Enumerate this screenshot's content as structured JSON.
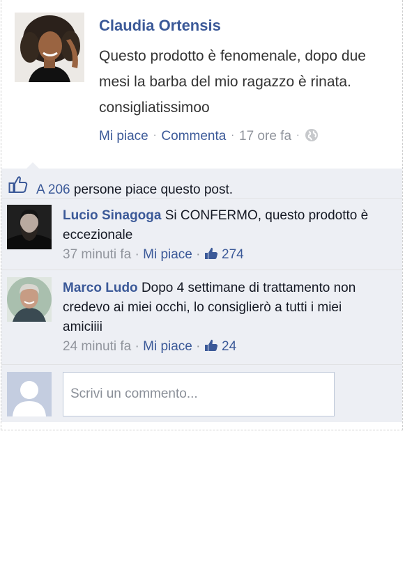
{
  "post": {
    "author": "Claudia Ortensis",
    "text": "Questo prodotto è fenomenale, dopo due mesi la barba del mio ragazzo è rinata. consigliatissimoo",
    "like_label": "Mi piace",
    "comment_label": "Commenta",
    "time": "17 ore fa",
    "separator": "·"
  },
  "likes": {
    "prefix": "A",
    "count": "206",
    "suffix": "persone piace questo post."
  },
  "comments": [
    {
      "author": "Lucio Sinagoga",
      "text": "Si CONFERMO, questo prodotto è eccezionale",
      "time": "37 minuti fa",
      "like_label": "Mi piace",
      "likes": "274"
    },
    {
      "author": "Marco Ludo",
      "text": "Dopo 4 settimane di trattamento non credevo ai miei occhi, lo consiglierò a tutti i miei amiciiii",
      "time": "24 minuti fa",
      "like_label": "Mi piace",
      "likes": "24"
    }
  ],
  "comment_box": {
    "placeholder": "Scrivi un commento..."
  },
  "icons": {
    "post_avatar": "woman-portrait-avatar",
    "globe": "globe-icon",
    "thumbs_up": "thumbs-up-icon",
    "default_avatar": "default-user-silhouette"
  },
  "colors": {
    "link": "#3b5998",
    "muted": "#90949c",
    "comments_bg": "#edeff4"
  }
}
